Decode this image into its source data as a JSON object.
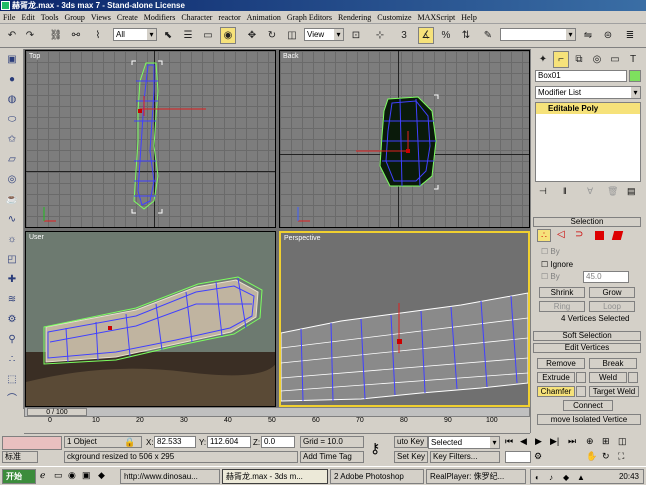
{
  "titlebar": {
    "title": "赫胥龙.max - 3ds max 7 - Stand-alone License"
  },
  "menu": [
    "File",
    "Edit",
    "Tools",
    "Group",
    "Views",
    "Create",
    "Modifiers",
    "Character",
    "reactor",
    "Animation",
    "Graph Editors",
    "Rendering",
    "Customize",
    "MAXScript",
    "Help"
  ],
  "toolbar": {
    "selection_filter": "All",
    "ref_coord": "View"
  },
  "viewports": {
    "top": "Top",
    "back": "Back",
    "user": "User",
    "perspective": "Perspective"
  },
  "panel": {
    "object_name": "Box01",
    "modifier_list": "Modifier List",
    "stack_item": "Editable Poly",
    "selection_header": "Selection",
    "by_vertex": "By",
    "ignore": "Ignore",
    "by_angle": "By",
    "angle_value": "45.0",
    "shrink": "Shrink",
    "grow": "Grow",
    "ring": "Ring",
    "loop": "Loop",
    "selected_info": "4 Vertices Selected",
    "soft_selection": "Soft Selection",
    "edit_vertices": "Edit Vertices",
    "remove": "Remove",
    "break": "Break",
    "extrude": "Extrude",
    "weld": "Weld",
    "chamfer": "Chamfer",
    "target_weld": "Target Weld",
    "connect": "Connect",
    "remove_isolated": "move Isolated Vertice"
  },
  "timeline": {
    "frame": "0 / 100"
  },
  "ruler": [
    "0",
    "10",
    "20",
    "30",
    "40",
    "50",
    "60",
    "70",
    "80",
    "90",
    "100"
  ],
  "status": {
    "selection": "1 Object",
    "x_label": "X:",
    "x_value": "82.533",
    "y_label": "Y:",
    "y_value": "112.604",
    "z_label": "Z:",
    "z_value": "0.0",
    "grid": "Grid = 10.0",
    "auto_key": "uto Key",
    "selected": "Selected",
    "set_key": "Set Key",
    "key_filters": "Key Filters...",
    "prompt": "ckground resized to 506 x 295",
    "add_time_tag": "Add Time Tag",
    "lang": "标准"
  },
  "taskbar": {
    "start": "开始",
    "tasks": [
      "http://www.dinosau...",
      "赫胥龙.max - 3ds m...",
      "2 Adobe Photoshop",
      "RealPlayer: 侏罗纪..."
    ],
    "clock": "20:43"
  }
}
